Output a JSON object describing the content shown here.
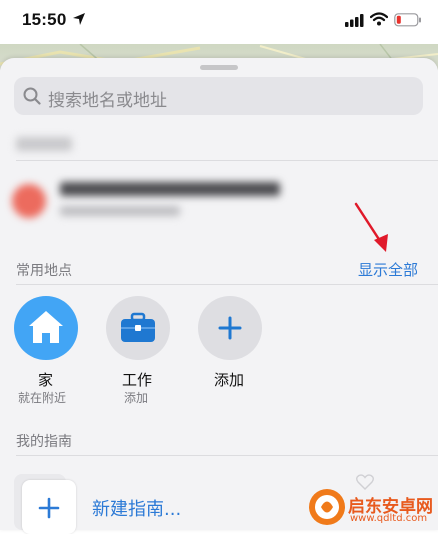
{
  "status_bar": {
    "time": "15:50"
  },
  "search": {
    "placeholder": "搜索地名或地址"
  },
  "favorites": {
    "section_label": "常用地点",
    "show_all_label": "显示全部",
    "items": [
      {
        "title": "家",
        "subtitle": "就在附近",
        "icon": "house-icon"
      },
      {
        "title": "工作",
        "subtitle": "添加",
        "icon": "briefcase-icon"
      },
      {
        "title": "添加",
        "subtitle": "",
        "icon": "plus-icon"
      }
    ]
  },
  "guides": {
    "section_label": "我的指南",
    "new_guide_label": "新建指南..."
  },
  "watermark": {
    "name": "启东安卓网",
    "url": "www.qdltd.com"
  },
  "colors": {
    "accent": "#2c7ad6",
    "home": "#42a5f5",
    "annotation": "#e0192a"
  }
}
